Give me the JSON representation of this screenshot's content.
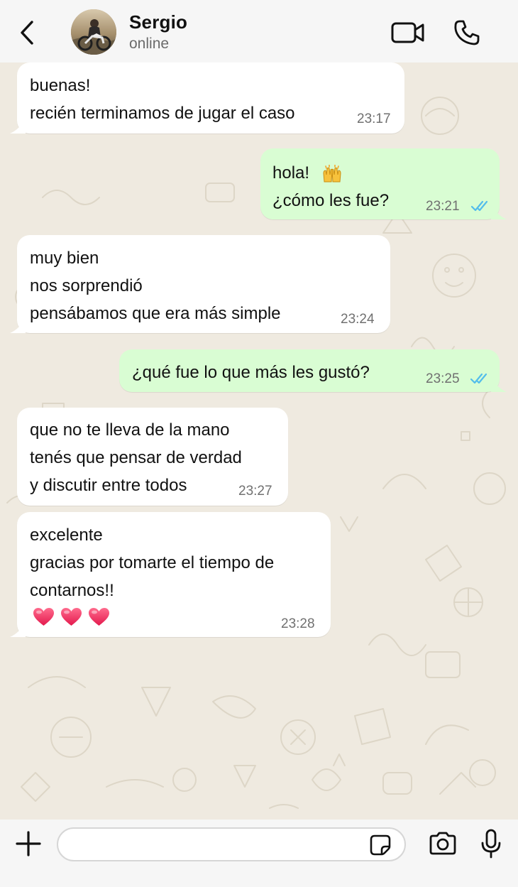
{
  "header": {
    "back_icon": "chevron-left-icon",
    "contact_name": "Sergio",
    "contact_status": "online",
    "video_icon": "video-camera-icon",
    "call_icon": "phone-icon"
  },
  "colors": {
    "header_bg": "#f6f6f6",
    "wallpaper_bg": "#efeae0",
    "incoming_bubble": "#ffffff",
    "outgoing_bubble": "#d9fdd3",
    "read_ticks": "#53bdeb",
    "timestamp": "#707070"
  },
  "messages": [
    {
      "direction": "incoming",
      "lines": [
        "buenas!",
        "recién terminamos de jugar el caso"
      ],
      "time": "23:17"
    },
    {
      "direction": "outgoing",
      "lines": [
        "hola!",
        "¿cómo les fue?"
      ],
      "emoji": "raising-hands-emoji",
      "time": "23:21",
      "status": "read"
    },
    {
      "direction": "incoming",
      "lines": [
        "muy bien",
        "nos sorprendió",
        "pensábamos que era más simple"
      ],
      "time": "23:24"
    },
    {
      "direction": "outgoing",
      "lines": [
        "¿qué fue lo que más les gustó?"
      ],
      "time": "23:25",
      "status": "read"
    },
    {
      "direction": "incoming",
      "lines": [
        "que no te lleva de la mano",
        "tenés que pensar de verdad",
        "y discutir entre todos"
      ],
      "time": "23:27"
    },
    {
      "direction": "incoming",
      "lines": [
        "excelente",
        "gracias por tomarte el tiempo de",
        "contarnos!!"
      ],
      "emojis": [
        "heart-emoji",
        "heart-emoji",
        "heart-emoji"
      ],
      "time": "23:28"
    }
  ],
  "input_bar": {
    "plus_icon": "plus-icon",
    "message_placeholder": "",
    "sticker_icon": "sticker-icon",
    "camera_icon": "camera-icon",
    "mic_icon": "microphone-icon"
  }
}
